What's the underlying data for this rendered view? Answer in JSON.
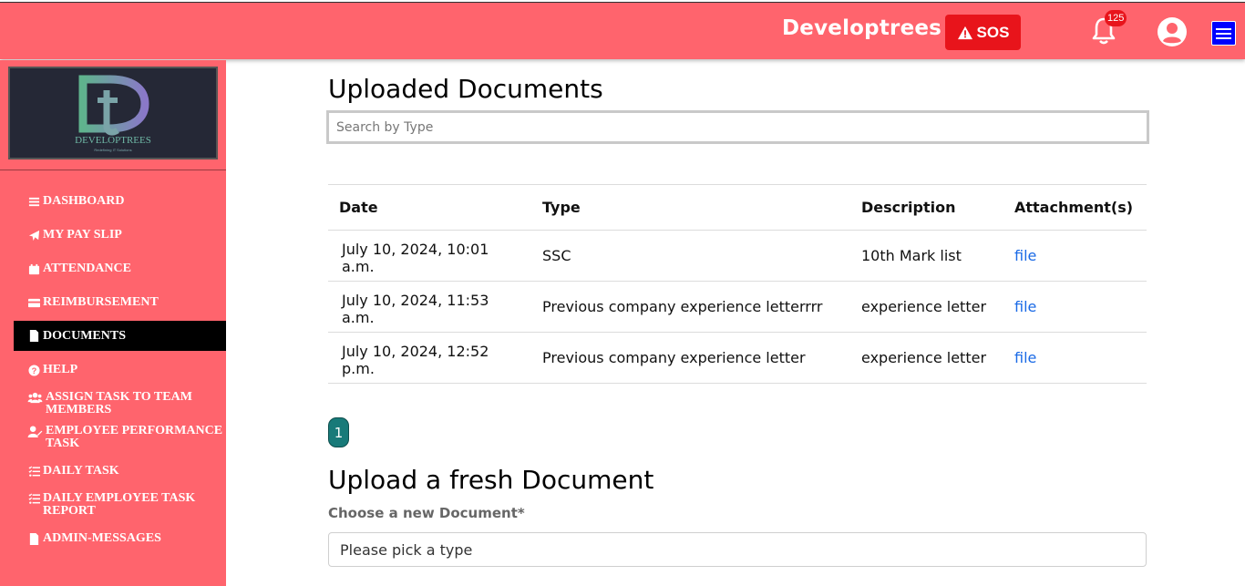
{
  "header": {
    "brand": "Developtrees",
    "sos_label": "SOS",
    "notification_count": "125"
  },
  "sidebar": {
    "logo_text": "DEVELOPTREES",
    "logo_tagline": "Redefining IT Solutions",
    "items": [
      {
        "label": "DASHBOARD",
        "icon": "list-icon"
      },
      {
        "label": "MY PAY SLIP",
        "icon": "paper-plane-icon"
      },
      {
        "label": "ATTENDANCE",
        "icon": "calendar-icon"
      },
      {
        "label": "REIMBURSEMENT",
        "icon": "credit-card-icon"
      },
      {
        "label": "DOCUMENTS",
        "icon": "file-icon"
      },
      {
        "label": "HELP",
        "icon": "question-circle-icon"
      },
      {
        "label": "ASSIGN TASK TO TEAM MEMBERS",
        "icon": "users-icon"
      },
      {
        "label": "EMPLOYEE PERFORMANCE TASK",
        "icon": "user-edit-icon"
      },
      {
        "label": "DAILY TASK",
        "icon": "tasks-icon"
      },
      {
        "label": "DAILY EMPLOYEE TASK REPORT",
        "icon": "tasks-icon"
      },
      {
        "label": "ADMIN-MESSAGES",
        "icon": "file-icon"
      }
    ]
  },
  "main": {
    "title": "Uploaded Documents",
    "search_placeholder": "Search by Type",
    "table": {
      "headers": [
        "Date",
        "Type",
        "Description",
        "Attachment(s)"
      ],
      "rows": [
        {
          "date": "July 10, 2024, 10:01 a.m.",
          "type": "SSC",
          "description": "10th Mark list",
          "attachment": "file"
        },
        {
          "date": "July 10, 2024, 11:53 a.m.",
          "type": "Previous company experience letterrrr",
          "description": "experience letter",
          "attachment": "file"
        },
        {
          "date": "July 10, 2024, 12:52 p.m.",
          "type": "Previous company experience letter",
          "description": "experience letter",
          "attachment": "file"
        }
      ]
    },
    "pagination": {
      "current_page": "1"
    },
    "upload_title": "Upload a fresh Document",
    "choose_label": "Choose a new Document*",
    "type_select_placeholder": "Please pick a type"
  },
  "colors": {
    "header_bg": "#ff646d",
    "sidebar_bg": "#ff646d",
    "sos_bg": "#e8141b",
    "active_nav_bg": "#000000",
    "pager_bg": "#187a79",
    "link": "#1a6ae6"
  }
}
